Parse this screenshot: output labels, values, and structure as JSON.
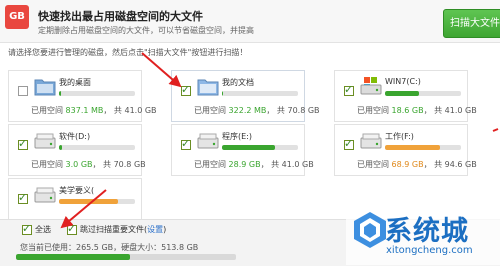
{
  "header": {
    "logo_text": "GB",
    "title": "快速找出最占用磁盘空间的大文件",
    "subtitle": "定期删除占用磁盘空间的大文件，可以节省磁盘空间，并提高",
    "scan_button": "扫描大文件"
  },
  "instruction": "请选择您要进行管理的磁盘，然后点击\"扫描大文件\"按钮进行扫描！",
  "disks": [
    {
      "name": "我的桌面",
      "used": "837.1 MB",
      "total": "共 41.0 GB",
      "fill": 0.02,
      "checked": false,
      "icon": "desktop-folder-icon",
      "color": "#3aa52f"
    },
    {
      "name": "我的文档",
      "used": "322.2 MB",
      "total": "共 70.8 GB",
      "fill": 0.01,
      "checked": true,
      "icon": "documents-folder-icon",
      "color": "#3aa52f"
    },
    {
      "name": "WIN7(C:)",
      "used": "18.6 GB",
      "total": "共 41.0 GB",
      "fill": 0.45,
      "checked": true,
      "icon": "windows-drive-icon",
      "color": "#3aa52f"
    },
    {
      "name": "软件(D:)",
      "used": "3.0 GB",
      "total": "共 70.8 GB",
      "fill": 0.04,
      "checked": true,
      "icon": "hard-drive-icon",
      "color": "#3aa52f"
    },
    {
      "name": "程序(E:)",
      "used": "28.9 GB",
      "total": "共 41.0 GB",
      "fill": 0.7,
      "checked": true,
      "icon": "hard-drive-icon",
      "color": "#3aa52f"
    },
    {
      "name": "工作(F:)",
      "used": "68.9 GB",
      "total": "共 94.6 GB",
      "fill": 0.73,
      "checked": true,
      "icon": "hard-drive-icon",
      "color": "#f0a23a"
    },
    {
      "name": "美学要义(",
      "used": "",
      "total": "",
      "fill": 0.78,
      "checked": true,
      "icon": "hard-drive-icon",
      "color": "#f0a23a"
    }
  ],
  "labels": {
    "used_prefix": "已用空间",
    "comma": "，"
  },
  "footer": {
    "select_all": "全选",
    "skip_important": "跳过扫描重要文件(",
    "settings_link": "设置",
    "close_paren": ")",
    "summary": "您当前已使用：265.5 GB，硬盘大小：513.8 GB",
    "total_fill": 0.52
  },
  "watermark": {
    "text": "系统城",
    "url": "xitongcheng.com"
  },
  "colors": {
    "accent_green": "#3aa52f",
    "warn_orange": "#f0a23a",
    "arrow_red": "#e02020",
    "brand_blue": "#1c6fc2"
  }
}
